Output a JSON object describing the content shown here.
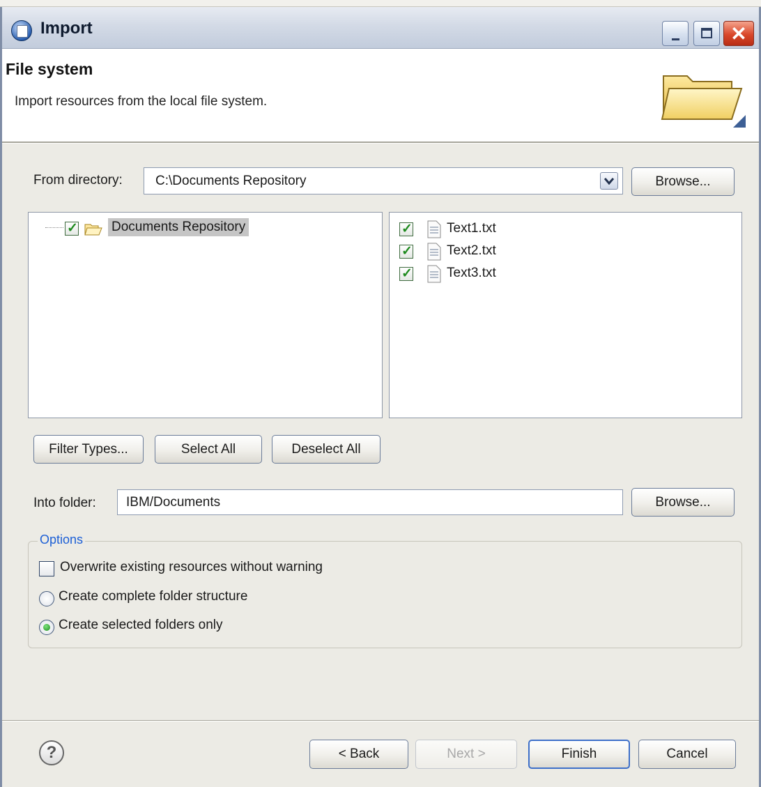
{
  "window": {
    "title": "Import"
  },
  "header": {
    "title": "File system",
    "description": "Import resources from the local file system."
  },
  "source": {
    "from_label": "From directory:",
    "from_value": "C:\\Documents Repository",
    "browse_label": "Browse..."
  },
  "tree": {
    "items": [
      {
        "label": "Documents Repository",
        "checked": true
      }
    ]
  },
  "files": {
    "items": [
      {
        "name": "Text1.txt",
        "checked": true
      },
      {
        "name": "Text2.txt",
        "checked": true
      },
      {
        "name": "Text3.txt",
        "checked": true
      }
    ]
  },
  "selection_buttons": {
    "filter": "Filter Types...",
    "select_all": "Select All",
    "deselect_all": "Deselect All"
  },
  "destination": {
    "into_label": "Into folder:",
    "into_value": "IBM/Documents",
    "browse_label": "Browse..."
  },
  "options": {
    "legend": "Options",
    "overwrite": {
      "label": "Overwrite existing resources without warning",
      "checked": false
    },
    "complete_structure": {
      "label": "Create complete folder structure",
      "selected": false
    },
    "selected_only": {
      "label": "Create selected folders only",
      "selected": true
    }
  },
  "footer": {
    "help_glyph": "?",
    "back": "< Back",
    "next": "Next >",
    "finish": "Finish",
    "cancel": "Cancel"
  },
  "colors": {
    "accent_check": "#1d8a1d",
    "options_legend": "#1c5fd6",
    "close_button": "#d9472a"
  },
  "icons": [
    "import-app-icon",
    "minimize-icon",
    "maximize-icon",
    "close-icon",
    "folder-large-icon",
    "chevron-down-icon",
    "folder-icon",
    "text-file-icon",
    "help-icon"
  ]
}
